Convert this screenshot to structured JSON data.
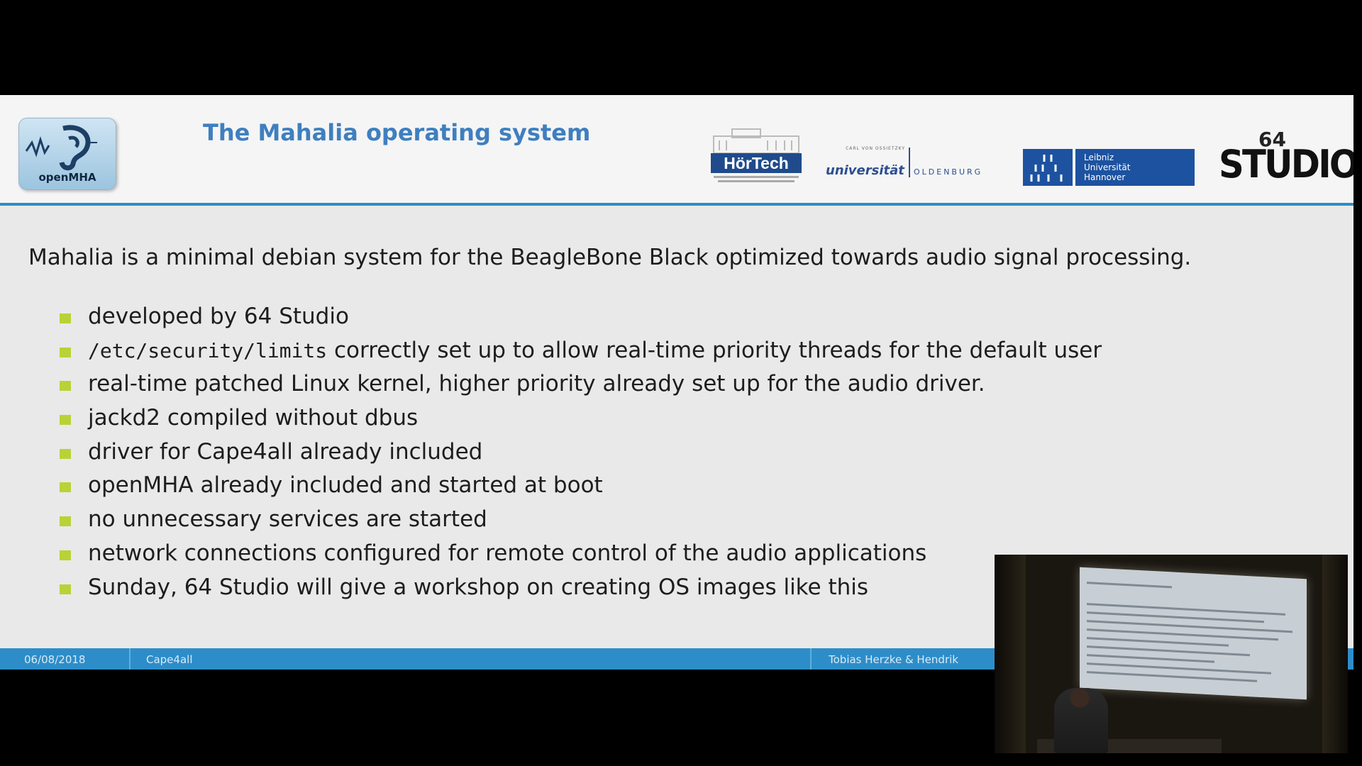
{
  "slide": {
    "title": "The Mahalia operating system",
    "logos": {
      "openmha": "openMHA",
      "hoertech": "HörTech",
      "uol_carl": "CARL VON OSSIETZKY",
      "uol_uni": "universität",
      "uol_city": "OLDENBURG",
      "luh_line1": "Leibniz",
      "luh_line2": "Universität",
      "luh_line3": "Hannover",
      "studio_sup": "64",
      "studio_word": "STUDIO"
    },
    "intro": "Mahalia is a minimal debian system for the BeagleBone Black optimized towards audio signal processing.",
    "bullets": [
      "developed by 64 Studio",
      "correctly set up to allow real-time priority threads for the default user",
      "real-time patched Linux kernel, higher priority already set up for the audio driver.",
      "jackd2 compiled without dbus",
      "driver for Cape4all already included",
      "openMHA already included and started at boot",
      "no unnecessary services are started",
      "network connections configured for remote control of the audio applications",
      "Sunday, 64 Studio will give a workshop on creating OS images like this"
    ],
    "bullet_code": "/etc/security/limits",
    "bullet_color": "#b8d336",
    "accent_color": "#2d8dc9",
    "footer": {
      "date": "06/08/2018",
      "project": "Cape4all",
      "authors": "Tobias Herzke & Hendrik"
    }
  }
}
